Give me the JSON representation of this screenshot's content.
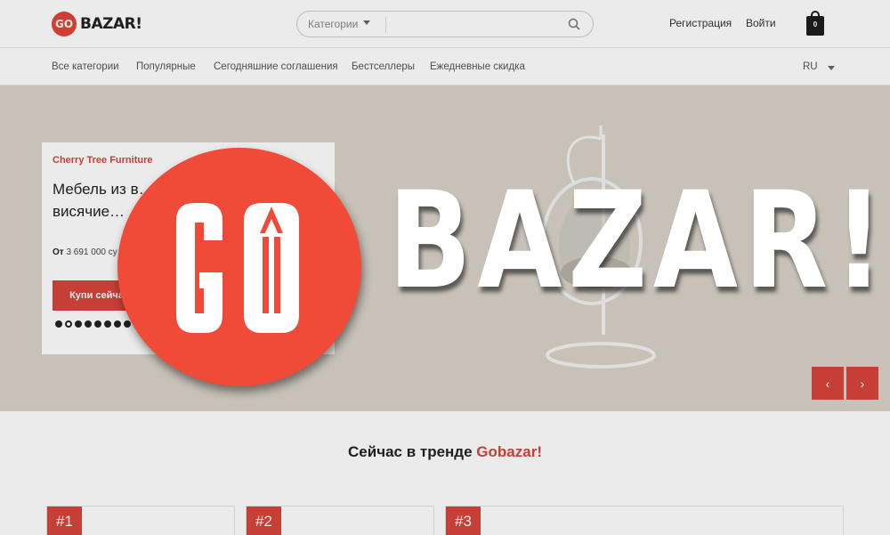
{
  "header": {
    "logo_circle_text": "GO",
    "logo_word": "BAZAR!",
    "search": {
      "category_label": "Категории",
      "placeholder": ""
    },
    "register_label": "Регистрация",
    "login_label": "Войти",
    "cart_count": "0"
  },
  "nav": {
    "items": [
      {
        "label": "Все категории"
      },
      {
        "label": "Популярные"
      },
      {
        "label": "Сегодняшние соглашения"
      },
      {
        "label": "Бестселлеры"
      },
      {
        "label": "Ежедневные скидка"
      }
    ],
    "language": "RU"
  },
  "hero": {
    "brand": "Cherry Tree Furniture",
    "title": "Мебель из в… BREEZE бе… висячие…",
    "price_prefix": "От",
    "price_value": "3 691 000 су…",
    "buy_button": "Купи сейча…",
    "slide_count": 8,
    "active_slide": 2,
    "prev_icon": "chevron-left-icon",
    "next_icon": "chevron-right-icon"
  },
  "overlay_logo": {
    "word": "BAZAR!"
  },
  "trending": {
    "title_prefix": "Сейчас в тренде",
    "title_brand": "Gobazar!",
    "tiles": [
      {
        "badge": "#1"
      },
      {
        "badge": "#2"
      },
      {
        "badge": "#3"
      }
    ]
  },
  "colors": {
    "accent": "#d6453b",
    "overlay_circle": "#f04a38",
    "hero_bg": "#d8d2c8"
  }
}
